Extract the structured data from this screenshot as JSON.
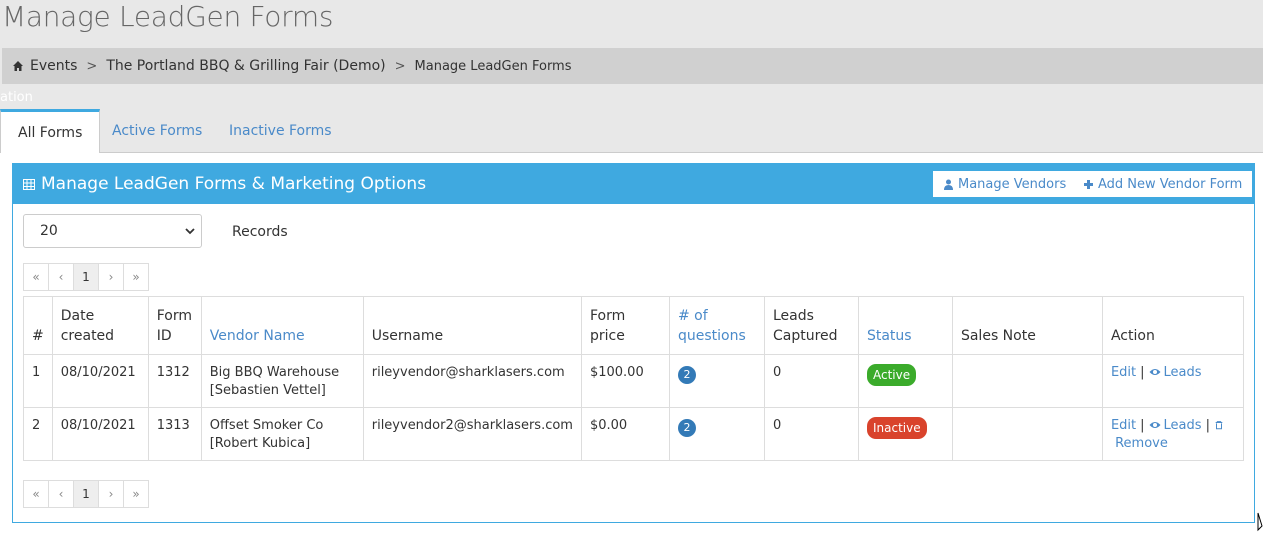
{
  "page": {
    "title": "Manage LeadGen Forms"
  },
  "breadcrumb": {
    "items": [
      "Events",
      "The Portland BBQ & Grilling Fair (Demo)"
    ],
    "current": "Manage LeadGen Forms"
  },
  "ghost_text": "ation",
  "tabs": [
    {
      "label": "All Forms"
    },
    {
      "label": "Active Forms"
    },
    {
      "label": "Inactive Forms"
    }
  ],
  "panel": {
    "title": "Manage LeadGen Forms & Marketing Options",
    "manage_vendors": "Manage Vendors",
    "add_vendor_form": "Add New Vendor Form"
  },
  "records": {
    "selected": "20",
    "label": "Records"
  },
  "pager": {
    "first": "«",
    "prev": "‹",
    "page": "1",
    "next": "›",
    "last": "»"
  },
  "table": {
    "headers": {
      "num": "#",
      "date": "Date created",
      "form_id": "Form ID",
      "vendor": "Vendor Name",
      "username": "Username",
      "price": "Form price",
      "questions": "# of questions",
      "leads": "Leads Captured",
      "status": "Status",
      "note": "Sales Note",
      "action": "Action"
    },
    "rows": [
      {
        "num": "1",
        "date": "08/10/2021",
        "form_id": "1312",
        "vendor": "Big BBQ Warehouse",
        "contact": "[Sebastien Vettel]",
        "username": "rileyvendor@sharklasers.com",
        "price": "$100.00",
        "questions": "2",
        "leads": "0",
        "status": "Active",
        "note": "",
        "edit": "Edit",
        "leads_link": "Leads"
      },
      {
        "num": "2",
        "date": "08/10/2021",
        "form_id": "1313",
        "vendor": "Offset Smoker Co",
        "contact": "[Robert Kubica]",
        "username": "rileyvendor2@sharklasers.com",
        "price": "$0.00",
        "questions": "2",
        "leads": "0",
        "status": "Inactive",
        "note": "",
        "edit": "Edit",
        "leads_link": "Leads",
        "remove": "Remove"
      }
    ]
  },
  "colors": {
    "accent": "#3fa9e0",
    "link": "#4a8ac9",
    "active": "#3bab2b",
    "inactive": "#d9432c",
    "badge": "#337ab7"
  }
}
